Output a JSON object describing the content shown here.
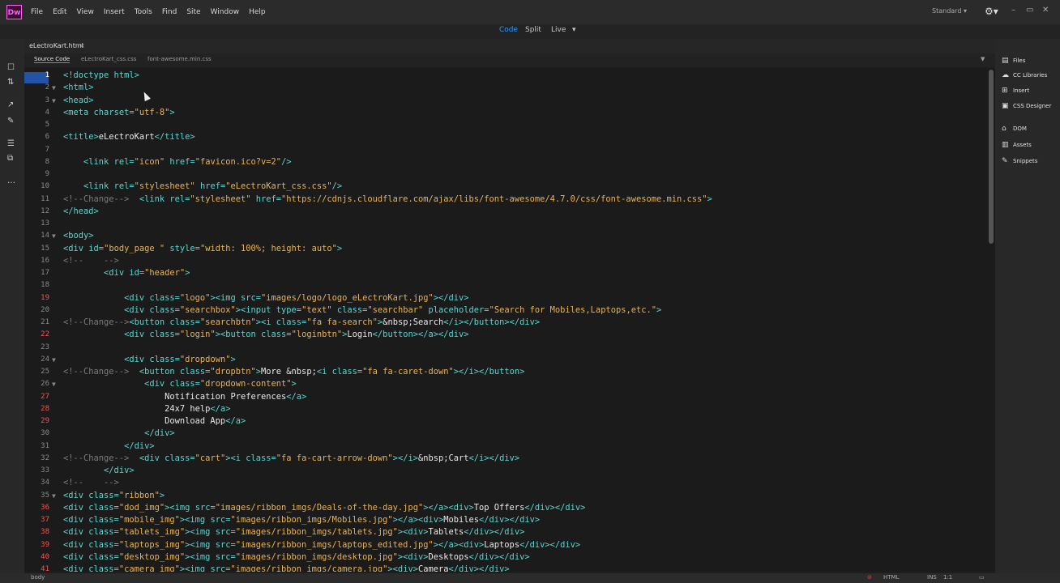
{
  "app": {
    "logo": "Dw",
    "workspace": "Standard",
    "gear": "⚙▾"
  },
  "menu": [
    "File",
    "Edit",
    "View",
    "Insert",
    "Tools",
    "Find",
    "Site",
    "Window",
    "Help"
  ],
  "window_controls": [
    "–",
    "▭",
    "✕"
  ],
  "view_modes": {
    "code": "Code",
    "split": "Split",
    "live": "Live",
    "live_arrow": "▾"
  },
  "document": {
    "tab": "eLectroKart.html",
    "close": "×"
  },
  "related_files": [
    "Source Code",
    "eLectroKart_css.css",
    "font-awesome.min.css"
  ],
  "right_panels": [
    {
      "label": "Files",
      "icon": "▤"
    },
    {
      "label": "CC Libraries",
      "icon": "☁"
    },
    {
      "label": "Insert",
      "icon": "⊞"
    },
    {
      "label": "CSS Designer",
      "icon": "▣"
    },
    {
      "label": "DOM",
      "icon": "⌂"
    },
    {
      "label": "Assets",
      "icon": "▥"
    },
    {
      "label": "Snippets",
      "icon": "✎"
    }
  ],
  "left_icons": [
    "☐",
    "⇅",
    "↗",
    "✎",
    "☰",
    "⧉",
    "…"
  ],
  "status": {
    "tag": "body",
    "lang": "HTML",
    "ins": "INS",
    "pos": "1:1"
  },
  "code_lines": [
    {
      "n": 1,
      "segs": [
        [
          "tag",
          "<!doctype html>"
        ]
      ]
    },
    {
      "n": 2,
      "segs": [
        [
          "tag",
          "<html>"
        ]
      ]
    },
    {
      "n": 3,
      "segs": [
        [
          "tag",
          "<head>"
        ]
      ]
    },
    {
      "n": 4,
      "segs": [
        [
          "tag",
          "<meta "
        ],
        [
          "attr",
          "charset="
        ],
        [
          "str",
          "\"utf-8\""
        ],
        [
          "tag",
          ">"
        ]
      ]
    },
    {
      "n": 5,
      "segs": []
    },
    {
      "n": 6,
      "segs": [
        [
          "tag",
          "<title>"
        ],
        [
          "txt",
          "eLectroKart"
        ],
        [
          "tag",
          "</title>"
        ]
      ]
    },
    {
      "n": 7,
      "segs": []
    },
    {
      "n": 8,
      "segs": [
        [
          "txt",
          "    "
        ],
        [
          "tag",
          "<link "
        ],
        [
          "attr",
          "rel="
        ],
        [
          "str",
          "\"icon\""
        ],
        [
          "attr",
          " href="
        ],
        [
          "str",
          "\"favicon.ico?v=2\""
        ],
        [
          "tag",
          "/>"
        ]
      ]
    },
    {
      "n": 9,
      "segs": []
    },
    {
      "n": 10,
      "segs": [
        [
          "txt",
          "    "
        ],
        [
          "tag",
          "<link "
        ],
        [
          "attr",
          "rel="
        ],
        [
          "str",
          "\"stylesheet\""
        ],
        [
          "attr",
          " href="
        ],
        [
          "str",
          "\"eLectroKart_css.css\""
        ],
        [
          "tag",
          "/>"
        ]
      ]
    },
    {
      "n": 11,
      "segs": [
        [
          "cmt",
          "<!--Change-->  "
        ],
        [
          "tag",
          "<link "
        ],
        [
          "attr",
          "rel="
        ],
        [
          "str",
          "\"stylesheet\""
        ],
        [
          "attr",
          " href="
        ],
        [
          "str",
          "\"https://cdnjs.cloudflare.com/ajax/libs/font-awesome/4.7.0/css/font-awesome.min.css\""
        ],
        [
          "tag",
          ">"
        ]
      ]
    },
    {
      "n": 12,
      "segs": [
        [
          "tag",
          "</head>"
        ]
      ]
    },
    {
      "n": 13,
      "segs": []
    },
    {
      "n": 14,
      "segs": [
        [
          "tag",
          "<body>"
        ]
      ]
    },
    {
      "n": 15,
      "segs": [
        [
          "tag",
          "<div "
        ],
        [
          "attr",
          "id="
        ],
        [
          "str",
          "\"body_page \""
        ],
        [
          "attr",
          " style="
        ],
        [
          "str",
          "\"width: 100%; height: auto\""
        ],
        [
          "tag",
          ">"
        ]
      ]
    },
    {
      "n": 16,
      "segs": [
        [
          "cmt",
          "<!--    -->"
        ]
      ]
    },
    {
      "n": 17,
      "segs": [
        [
          "txt",
          "        "
        ],
        [
          "tag",
          "<div "
        ],
        [
          "attr",
          "id="
        ],
        [
          "str",
          "\"header\""
        ],
        [
          "tag",
          ">"
        ]
      ]
    },
    {
      "n": 18,
      "segs": []
    },
    {
      "n": 19,
      "segs": [
        [
          "txt",
          "            "
        ],
        [
          "tag",
          "<div "
        ],
        [
          "attr",
          "class="
        ],
        [
          "str",
          "\"logo\""
        ],
        [
          "tag",
          "><img "
        ],
        [
          "attr",
          "src="
        ],
        [
          "str",
          "\"images/logo/logo_eLectroKart.jpg\""
        ],
        [
          "tag",
          "></div>"
        ]
      ]
    },
    {
      "n": 20,
      "segs": [
        [
          "txt",
          "            "
        ],
        [
          "tag",
          "<div "
        ],
        [
          "attr",
          "class="
        ],
        [
          "str",
          "\"searchbox\""
        ],
        [
          "tag",
          "><input "
        ],
        [
          "attr",
          "type="
        ],
        [
          "str",
          "\"text\""
        ],
        [
          "attr",
          " class="
        ],
        [
          "str",
          "\"searchbar\""
        ],
        [
          "attr",
          " placeholder="
        ],
        [
          "str",
          "\"Search for Mobiles,Laptops,etc.\""
        ],
        [
          "tag",
          ">"
        ]
      ]
    },
    {
      "n": 21,
      "segs": [
        [
          "cmt",
          "<!--Change-->"
        ],
        [
          "tag",
          "<button "
        ],
        [
          "attr",
          "class="
        ],
        [
          "str",
          "\"searchbtn\""
        ],
        [
          "tag",
          "><i "
        ],
        [
          "attr",
          "class="
        ],
        [
          "str",
          "\"fa fa-search\""
        ],
        [
          "tag",
          ">"
        ],
        [
          "txt",
          "&nbsp;Search"
        ],
        [
          "tag",
          "</i></button></div>"
        ]
      ]
    },
    {
      "n": 22,
      "segs": [
        [
          "txt",
          "            "
        ],
        [
          "tag",
          "<div "
        ],
        [
          "attr",
          "class="
        ],
        [
          "str",
          "\"login\""
        ],
        [
          "tag",
          "><button "
        ],
        [
          "attr",
          "class="
        ],
        [
          "str",
          "\"loginbtn\""
        ],
        [
          "tag",
          ">"
        ],
        [
          "txt",
          "Login"
        ],
        [
          "tag",
          "</button></a></div>"
        ]
      ]
    },
    {
      "n": 23,
      "segs": []
    },
    {
      "n": 24,
      "segs": [
        [
          "txt",
          "            "
        ],
        [
          "tag",
          "<div "
        ],
        [
          "attr",
          "class="
        ],
        [
          "str",
          "\"dropdown\""
        ],
        [
          "tag",
          ">"
        ]
      ]
    },
    {
      "n": 25,
      "segs": [
        [
          "cmt",
          "<!--Change-->  "
        ],
        [
          "tag",
          "<button "
        ],
        [
          "attr",
          "class="
        ],
        [
          "str",
          "\"dropbtn\""
        ],
        [
          "tag",
          ">"
        ],
        [
          "txt",
          "More &nbsp;"
        ],
        [
          "tag",
          "<i "
        ],
        [
          "attr",
          "class="
        ],
        [
          "str",
          "\"fa fa-caret-down\""
        ],
        [
          "tag",
          "></i></button>"
        ]
      ]
    },
    {
      "n": 26,
      "segs": [
        [
          "txt",
          "                "
        ],
        [
          "tag",
          "<div "
        ],
        [
          "attr",
          "class="
        ],
        [
          "str",
          "\"dropdown-content\""
        ],
        [
          "tag",
          ">"
        ]
      ]
    },
    {
      "n": 27,
      "segs": [
        [
          "txt",
          "                    Notification Preferences"
        ],
        [
          "tag",
          "</a>"
        ]
      ]
    },
    {
      "n": 28,
      "segs": [
        [
          "txt",
          "                    24x7 help"
        ],
        [
          "tag",
          "</a>"
        ]
      ]
    },
    {
      "n": 29,
      "segs": [
        [
          "txt",
          "                    Download App"
        ],
        [
          "tag",
          "</a>"
        ]
      ]
    },
    {
      "n": 30,
      "segs": [
        [
          "txt",
          "                "
        ],
        [
          "tag",
          "</div>"
        ]
      ]
    },
    {
      "n": 31,
      "segs": [
        [
          "txt",
          "            "
        ],
        [
          "tag",
          "</div>"
        ]
      ]
    },
    {
      "n": 32,
      "segs": [
        [
          "cmt",
          "<!--Change-->  "
        ],
        [
          "tag",
          "<div "
        ],
        [
          "attr",
          "class="
        ],
        [
          "str",
          "\"cart\""
        ],
        [
          "tag",
          "><i "
        ],
        [
          "attr",
          "class="
        ],
        [
          "str",
          "\"fa fa-cart-arrow-down\""
        ],
        [
          "tag",
          "></i>"
        ],
        [
          "txt",
          "&nbsp;Cart"
        ],
        [
          "tag",
          "</i></div>"
        ]
      ]
    },
    {
      "n": 33,
      "segs": [
        [
          "txt",
          "        "
        ],
        [
          "tag",
          "</div>"
        ]
      ]
    },
    {
      "n": 34,
      "segs": [
        [
          "cmt",
          "<!--    -->"
        ]
      ]
    },
    {
      "n": 35,
      "segs": [
        [
          "tag",
          "<div "
        ],
        [
          "attr",
          "class="
        ],
        [
          "str",
          "\"ribbon\""
        ],
        [
          "tag",
          ">"
        ]
      ]
    },
    {
      "n": 36,
      "segs": [
        [
          "tag",
          "<div "
        ],
        [
          "attr",
          "class="
        ],
        [
          "str",
          "\"dod_img\""
        ],
        [
          "tag",
          "><img "
        ],
        [
          "attr",
          "src="
        ],
        [
          "str",
          "\"images/ribbon_imgs/Deals-of-the-day.jpg\""
        ],
        [
          "tag",
          "></a><div>"
        ],
        [
          "txt",
          "Top Offers"
        ],
        [
          "tag",
          "</div></div>"
        ]
      ]
    },
    {
      "n": 37,
      "segs": [
        [
          "tag",
          "<div "
        ],
        [
          "attr",
          "class="
        ],
        [
          "str",
          "\"mobile_img\""
        ],
        [
          "tag",
          "><img "
        ],
        [
          "attr",
          "src="
        ],
        [
          "str",
          "\"images/ribbon_imgs/Mobiles.jpg\""
        ],
        [
          "tag",
          "></a><div>"
        ],
        [
          "txt",
          "Mobiles"
        ],
        [
          "tag",
          "</div></div>"
        ]
      ]
    },
    {
      "n": 38,
      "segs": [
        [
          "tag",
          "<div "
        ],
        [
          "attr",
          "class="
        ],
        [
          "str",
          "\"tablets_img\""
        ],
        [
          "tag",
          "><img "
        ],
        [
          "attr",
          "src="
        ],
        [
          "str",
          "\"images/ribbon_imgs/tablets.jpg\""
        ],
        [
          "tag",
          "><div>"
        ],
        [
          "txt",
          "Tablets"
        ],
        [
          "tag",
          "</div></div>"
        ]
      ]
    },
    {
      "n": 39,
      "segs": [
        [
          "tag",
          "<div "
        ],
        [
          "attr",
          "class="
        ],
        [
          "str",
          "\"laptops_img\""
        ],
        [
          "tag",
          "><img "
        ],
        [
          "attr",
          "src="
        ],
        [
          "str",
          "\"images/ribbon_imgs/laptops_edited.jpg\""
        ],
        [
          "tag",
          "></a><div>"
        ],
        [
          "txt",
          "Laptops"
        ],
        [
          "tag",
          "</div></div>"
        ]
      ]
    },
    {
      "n": 40,
      "segs": [
        [
          "tag",
          "<div "
        ],
        [
          "attr",
          "class="
        ],
        [
          "str",
          "\"desktop_img\""
        ],
        [
          "tag",
          "><img "
        ],
        [
          "attr",
          "src="
        ],
        [
          "str",
          "\"images/ribbon_imgs/desktop.jpg\""
        ],
        [
          "tag",
          "><div>"
        ],
        [
          "txt",
          "Desktops"
        ],
        [
          "tag",
          "</div></div>"
        ]
      ]
    },
    {
      "n": 41,
      "segs": [
        [
          "tag",
          "<div "
        ],
        [
          "attr",
          "class="
        ],
        [
          "str",
          "\"camera_img\""
        ],
        [
          "tag",
          "><img "
        ],
        [
          "attr",
          "src="
        ],
        [
          "str",
          "\"images/ribbon_imgs/camera.jpg\""
        ],
        [
          "tag",
          "><div>"
        ],
        [
          "txt",
          "Camera"
        ],
        [
          "tag",
          "</div></div>"
        ]
      ]
    }
  ],
  "fold_lines": [
    2,
    3,
    14,
    24,
    26,
    35
  ],
  "error_lines": [
    19,
    22,
    27,
    28,
    29,
    36,
    37,
    38,
    39,
    40,
    41
  ],
  "current_line": 1
}
